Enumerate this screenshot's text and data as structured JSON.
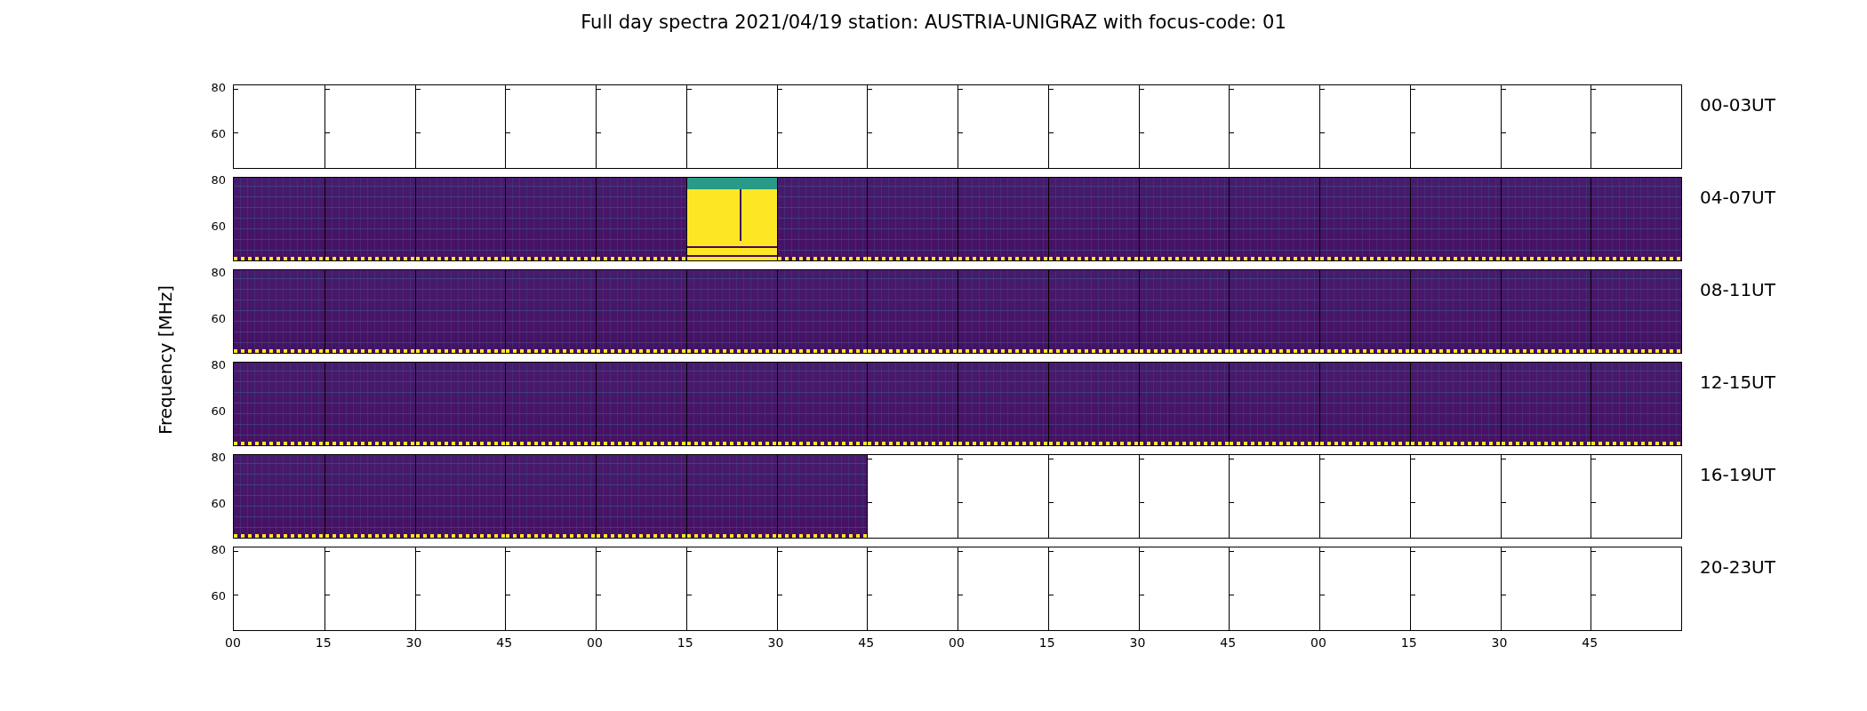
{
  "title": "Full day spectra 2021/04/19 station: AUSTRIA-UNIGRAZ with focus-code: 01",
  "ylabel": "Frequency [MHz]",
  "rows": [
    {
      "label": "00-03UT",
      "yticks": [
        "80",
        "60"
      ],
      "panels": [
        {
          "kind": "empty"
        },
        {
          "kind": "empty"
        },
        {
          "kind": "empty"
        },
        {
          "kind": "empty"
        },
        {
          "kind": "empty"
        },
        {
          "kind": "empty"
        },
        {
          "kind": "empty"
        },
        {
          "kind": "empty"
        },
        {
          "kind": "empty"
        },
        {
          "kind": "empty"
        },
        {
          "kind": "empty"
        },
        {
          "kind": "empty"
        },
        {
          "kind": "empty"
        },
        {
          "kind": "empty"
        },
        {
          "kind": "empty"
        },
        {
          "kind": "empty"
        }
      ]
    },
    {
      "label": "04-07UT",
      "yticks": [
        "80",
        "60"
      ],
      "panels": [
        {
          "kind": "spectrum"
        },
        {
          "kind": "spectrum"
        },
        {
          "kind": "spectrum"
        },
        {
          "kind": "spectrum"
        },
        {
          "kind": "spectrum"
        },
        {
          "kind": "saturated"
        },
        {
          "kind": "spectrum"
        },
        {
          "kind": "spectrum"
        },
        {
          "kind": "spectrum"
        },
        {
          "kind": "spectrum"
        },
        {
          "kind": "spectrum"
        },
        {
          "kind": "spectrum"
        },
        {
          "kind": "spectrum"
        },
        {
          "kind": "spectrum"
        },
        {
          "kind": "spectrum"
        },
        {
          "kind": "spectrum"
        }
      ]
    },
    {
      "label": "08-11UT",
      "yticks": [
        "80",
        "60"
      ],
      "panels": [
        {
          "kind": "spectrum"
        },
        {
          "kind": "spectrum"
        },
        {
          "kind": "spectrum"
        },
        {
          "kind": "spectrum"
        },
        {
          "kind": "spectrum"
        },
        {
          "kind": "spectrum"
        },
        {
          "kind": "spectrum"
        },
        {
          "kind": "spectrum"
        },
        {
          "kind": "spectrum"
        },
        {
          "kind": "spectrum"
        },
        {
          "kind": "spectrum"
        },
        {
          "kind": "spectrum"
        },
        {
          "kind": "spectrum"
        },
        {
          "kind": "spectrum"
        },
        {
          "kind": "spectrum"
        },
        {
          "kind": "spectrum"
        }
      ]
    },
    {
      "label": "12-15UT",
      "yticks": [
        "80",
        "60"
      ],
      "panels": [
        {
          "kind": "spectrum"
        },
        {
          "kind": "spectrum"
        },
        {
          "kind": "spectrum"
        },
        {
          "kind": "spectrum"
        },
        {
          "kind": "spectrum"
        },
        {
          "kind": "spectrum"
        },
        {
          "kind": "spectrum"
        },
        {
          "kind": "spectrum"
        },
        {
          "kind": "spectrum"
        },
        {
          "kind": "spectrum"
        },
        {
          "kind": "spectrum"
        },
        {
          "kind": "spectrum"
        },
        {
          "kind": "spectrum"
        },
        {
          "kind": "spectrum"
        },
        {
          "kind": "spectrum"
        },
        {
          "kind": "spectrum"
        }
      ]
    },
    {
      "label": "16-19UT",
      "yticks": [
        "80",
        "60"
      ],
      "panels": [
        {
          "kind": "spectrum"
        },
        {
          "kind": "spectrum"
        },
        {
          "kind": "spectrum"
        },
        {
          "kind": "spectrum"
        },
        {
          "kind": "spectrum"
        },
        {
          "kind": "spectrum"
        },
        {
          "kind": "spectrum"
        },
        {
          "kind": "empty"
        },
        {
          "kind": "empty"
        },
        {
          "kind": "empty"
        },
        {
          "kind": "empty"
        },
        {
          "kind": "empty"
        },
        {
          "kind": "empty"
        },
        {
          "kind": "empty"
        },
        {
          "kind": "empty"
        },
        {
          "kind": "empty"
        }
      ]
    },
    {
      "label": "20-23UT",
      "yticks": [
        "80",
        "60"
      ],
      "panels": [
        {
          "kind": "empty"
        },
        {
          "kind": "empty"
        },
        {
          "kind": "empty"
        },
        {
          "kind": "empty"
        },
        {
          "kind": "empty"
        },
        {
          "kind": "empty"
        },
        {
          "kind": "empty"
        },
        {
          "kind": "empty"
        },
        {
          "kind": "empty"
        },
        {
          "kind": "empty"
        },
        {
          "kind": "empty"
        },
        {
          "kind": "empty"
        },
        {
          "kind": "empty"
        },
        {
          "kind": "empty"
        },
        {
          "kind": "empty"
        },
        {
          "kind": "empty"
        }
      ]
    }
  ],
  "xticks": [
    "00",
    "15",
    "30",
    "45",
    "00",
    "15",
    "30",
    "45",
    "00",
    "15",
    "30",
    "45",
    "00",
    "15",
    "30",
    "45"
  ]
}
